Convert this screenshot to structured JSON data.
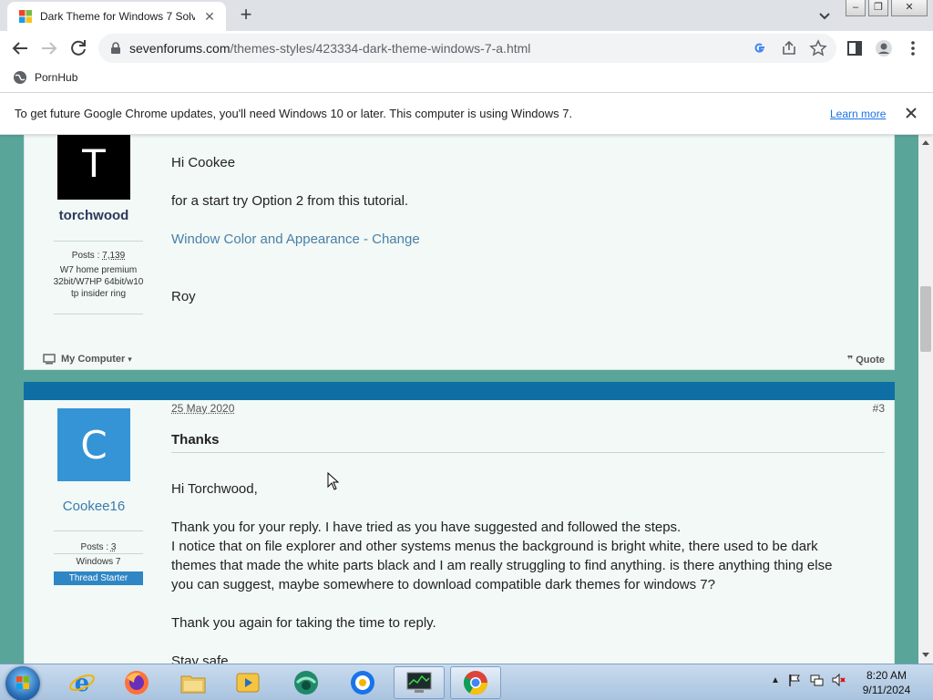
{
  "browser": {
    "tab_title": "Dark Theme for Windows 7 Solve",
    "new_tab": "+",
    "url_domain": "sevenforums.com",
    "url_path": "/themes-styles/423334-dark-theme-windows-7-a.html",
    "bookmark_label": "PornHub",
    "infobar_message": "To get future Google Chrome updates, you'll need Windows 10 or later. This computer is using Windows 7.",
    "infobar_link": "Learn more"
  },
  "posts": [
    {
      "avatar_letter": "T",
      "username": "torchwood",
      "posts_label": "Posts :",
      "posts_count": "7,139",
      "system": "W7 home premium 32bit/W7HP 64bit/w10 tp insider ring",
      "body": [
        "Hi Cookee",
        "for a start try Option 2 from this tutorial.",
        "Window Color and Appearance - Change",
        "Roy"
      ],
      "my_computer": "My Computer",
      "quote": "Quote"
    },
    {
      "date": "25 May 2020",
      "number": "#3",
      "avatar_letter": "C",
      "username": "Cookee16",
      "posts_label": "Posts :",
      "posts_count": "3",
      "system": "Windows 7",
      "badge": "Thread Starter",
      "title": "Thanks",
      "body": [
        "Hi Torchwood,",
        "Thank you for your reply. I have tried as you have suggested and followed the steps.",
        "I notice that on file explorer and other systems menus the background is bright white, there used to be dark",
        "themes that made the white parts black and I am really struggling to find anything. is there anything thing else",
        "you can suggest, maybe somewhere to download compatible dark themes for windows 7?",
        "Thank you again for taking the time to reply.",
        "Stay safe"
      ]
    }
  ],
  "taskbar": {
    "time": "8:20 AM",
    "date": "9/11/2024"
  },
  "colors": {
    "page_bg": "#59a59a",
    "post_bg": "#f2f9f6",
    "post_header": "#0f6fa4",
    "link": "#4a7fa8",
    "badge": "#2f86c5"
  }
}
